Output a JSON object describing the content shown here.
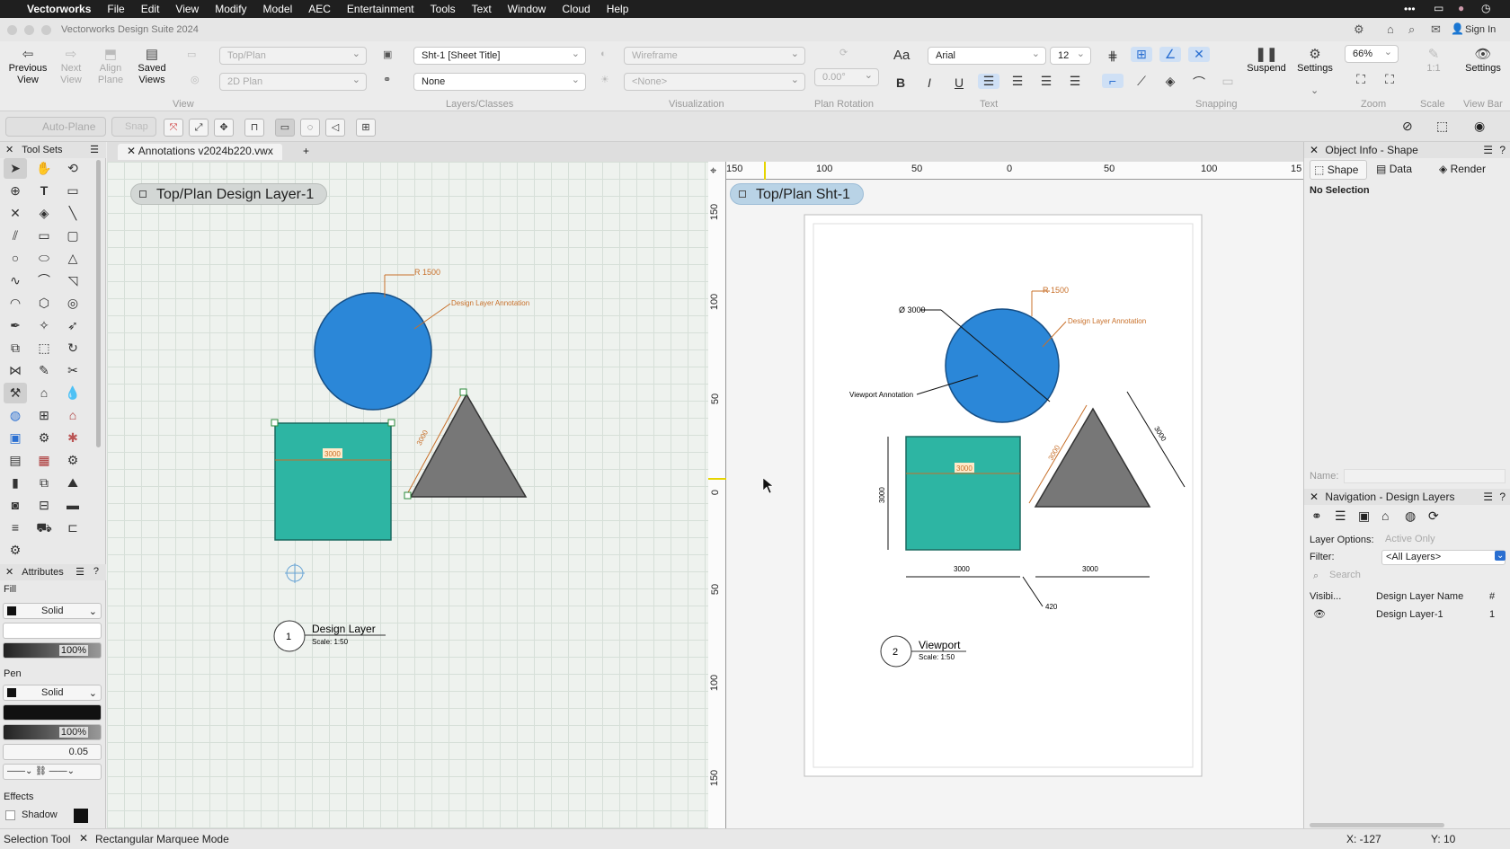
{
  "menubar": {
    "app": "Vectorworks",
    "items": [
      "File",
      "Edit",
      "View",
      "Modify",
      "Model",
      "AEC",
      "Entertainment",
      "Tools",
      "Text",
      "Window",
      "Cloud",
      "Help"
    ],
    "more": "•••"
  },
  "window": {
    "title": "Vectorworks Design Suite 2024",
    "sign_in": "Sign In"
  },
  "toolbar": {
    "previous_view": "Previous View",
    "next_view": "Next View",
    "align_plane": "Align Plane",
    "saved_views": "Saved Views",
    "view_group": "View",
    "view_select": "Top/Plan",
    "render_select": "2D Plan",
    "sheet_select": "Sht-1 [Sheet Title]",
    "class_select": "None",
    "layers_group": "Layers/Classes",
    "render_mode": "Wireframe",
    "render_none": "<None>",
    "visualization_group": "Visualization",
    "plan_rotation_value": "0.00°",
    "plan_rotation_group": "Plan Rotation",
    "font_name": "Arial",
    "font_size": "12",
    "text_group": "Text",
    "snapping_group": "Snapping",
    "suspend": "Suspend",
    "settings": "Settings",
    "zoom_value": "66%",
    "zoom_group": "Zoom",
    "scale_value": "1:1",
    "scale_group": "Scale",
    "view_bar_settings": "Settings",
    "view_bar_group": "View Bar"
  },
  "modebar": {
    "auto_plane": "Auto-Plane",
    "snap_label": "Snap"
  },
  "tool_sets": {
    "title": "Tool Sets"
  },
  "attributes": {
    "title": "Attributes",
    "fill_label": "Fill",
    "fill_style": "Solid",
    "fill_opacity": "100%",
    "pen_label": "Pen",
    "pen_style": "Solid",
    "pen_opacity": "100%",
    "line_weight": "0.05",
    "effects_label": "Effects",
    "shadow_label": "Shadow"
  },
  "tabs": {
    "file_tab": "Annotations v2024b220.vwx",
    "add_tab": "+"
  },
  "design_layer_view": {
    "pill": "Top/Plan  Design Layer-1",
    "radius_label": "R 1500",
    "annotation_label": "Design Layer Annotation",
    "rect_dim": "3000",
    "tri_dim": "3000",
    "title_number": "1",
    "title_name": "Design Layer",
    "title_scale": "Scale: 1:50"
  },
  "sheet_view": {
    "pill": "Top/Plan  Sht-1",
    "ruler_top": [
      "150",
      "100",
      "50",
      "0",
      "50",
      "100",
      "15"
    ],
    "ruler_left": [
      "150",
      "100",
      "50",
      "0",
      "50",
      "100",
      "150"
    ],
    "radius_label": "R 1500",
    "diameter_label": "Ø 3000",
    "annotation_label": "Design Layer Annotation",
    "viewport_annotation": "Viewport Annotation",
    "rect_inner_dim": "3000",
    "rect_height_dim": "3000",
    "rect_width_dim": "3000",
    "tri_width_dim": "3000",
    "tri_side_dim": "3000",
    "tri_slant_dim": "3000",
    "gap_dim": "420",
    "title_number": "2",
    "title_name": "Viewport",
    "title_scale": "Scale: 1:50"
  },
  "object_info": {
    "title": "Object Info - Shape",
    "tab_shape": "Shape",
    "tab_data": "Data",
    "tab_render": "Render",
    "selection_text": "No Selection",
    "name_label": "Name:"
  },
  "navigation": {
    "title": "Navigation - Design Layers",
    "layer_options_label": "Layer Options:",
    "layer_options_value": "Active Only",
    "filter_label": "Filter:",
    "filter_value": "<All Layers>",
    "search_placeholder": "Search",
    "col_visibility": "Visibi...",
    "col_name": "Design Layer Name",
    "col_number": "#",
    "rows": [
      {
        "name": "Design Layer-1",
        "number": "1"
      }
    ]
  },
  "statusbar": {
    "tool": "Selection Tool",
    "mode": "Rectangular Marquee Mode",
    "x": "X: -127",
    "y": "Y: 10"
  },
  "colors": {
    "circle": "#2b87d8",
    "rect": "#2db5a3",
    "triangle": "#777777",
    "annotation": "#c8702a",
    "pill": "#b9d3e6"
  }
}
